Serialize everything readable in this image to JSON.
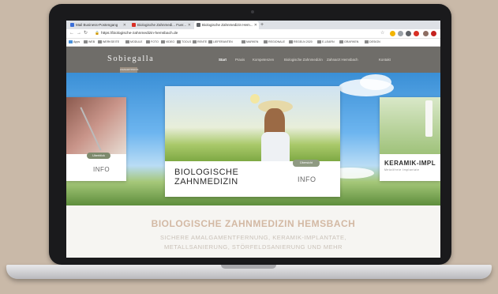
{
  "browser": {
    "tabs": [
      {
        "label": "Mail Business-Postengang",
        "favicon_color": "#3b6fd8"
      },
      {
        "label": "Biologische Zahnmedi... Fuer...",
        "favicon_color": "#d93025"
      },
      {
        "label": "Biologische Zahnmedizin Hem...",
        "favicon_color": "#5f6368"
      }
    ],
    "new_tab": "+",
    "url": "https://biologische-zahnmedizin-hemsbach.de",
    "bookmarks": [
      "Apps",
      "WEB",
      "WERKSEITE",
      "MODULE",
      "FOTO",
      "VIDEO",
      "TOOLS",
      "RENTE",
      "LIEFERANTEN",
      "MARKEN",
      "REGIONALE",
      "REGELN 2020",
      "E-LEARN",
      "GRAFIKEN",
      "DESIGN"
    ]
  },
  "site": {
    "logo": "Sobiegalla",
    "logo_tag": "ZAHNARZTPRAXIS",
    "nav": [
      "Start",
      "Praxis",
      "Kompetenzen",
      "Biologische Zahnmedizin",
      "Zahnarzt Hemsbach",
      "Kontakt"
    ],
    "active_nav": "Start"
  },
  "hero": {
    "cards": [
      {
        "title": "",
        "badge": "Uberblick",
        "info": "INFO"
      },
      {
        "title_line1": "BIOLOGISCHE",
        "title_line2": "ZAHNMEDIZIN",
        "badge": "Übersicht",
        "info": "INFO"
      },
      {
        "title": "KERAMIK-IMPL",
        "subtitle": "Metallfreie Implantate"
      }
    ],
    "dots_count": 12
  },
  "content": {
    "headline": "BIOLOGISCHE ZAHNMEDIZIN HEMSBACH",
    "sub_line1": "SICHERE AMALGAMENTFERNUNG, KERAMIK-IMPLANTATE,",
    "sub_line2": "METALLSANIERUNG, STÖRFELDSANIERUNG UND MEHR"
  },
  "colors": {
    "header_bg": "#6f6d69",
    "headline": "#d3b9a4",
    "badge": "#7d8a6d"
  }
}
